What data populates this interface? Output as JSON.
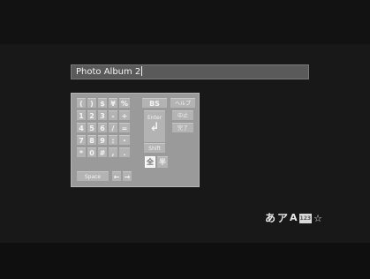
{
  "input": {
    "value": "Photo Album 2"
  },
  "keyboard": {
    "row1": [
      "(",
      ")",
      "$",
      "¥",
      "%"
    ],
    "row2": [
      "1",
      "2",
      "3",
      "-",
      "+"
    ],
    "row3": [
      "4",
      "5",
      "6",
      "/",
      "="
    ],
    "row4": [
      "7",
      "8",
      "9",
      ":",
      "・"
    ],
    "row5": [
      "*",
      "0",
      "#",
      ",",
      "."
    ],
    "bs": "BS",
    "help": "ヘルプ",
    "enter": "Enter",
    "enter_arrow": "↲",
    "cancel": "中止",
    "done": "完了",
    "shift": "Shift",
    "fullwidth": "全",
    "halfwidth": "半",
    "space": "Space",
    "left": "←",
    "right": "→"
  },
  "mode_indicator": {
    "hiragana": "あ",
    "katakana": "ア",
    "alpha": "A",
    "numeric": "123",
    "symbol": "☆"
  }
}
